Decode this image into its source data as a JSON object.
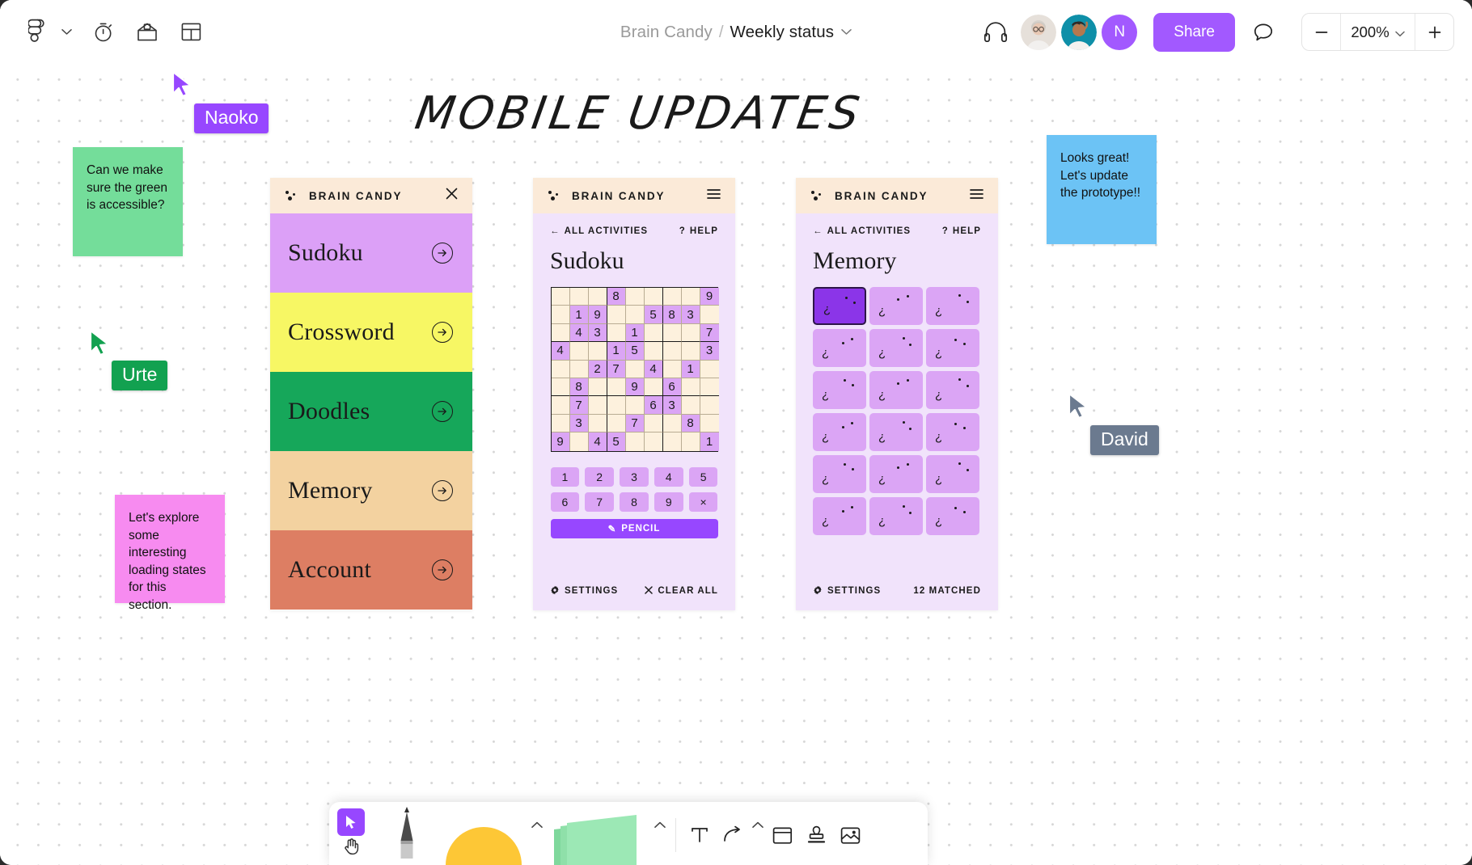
{
  "topbar": {
    "logo_icon": "figjam-logo-icon",
    "menu_caret_icon": "chevron-down-icon",
    "timer_icon": "timer-icon",
    "widget_icon": "widget-tray-icon",
    "template_icon": "template-icon",
    "breadcrumb": {
      "team": "Brain Candy",
      "separator": "/",
      "file": "Weekly status",
      "caret_icon": "chevron-down-icon"
    },
    "audio_icon": "headphones-icon",
    "avatars": [
      {
        "name": "collaborator-photo-1",
        "type": "photo",
        "accent": "#d9d2cc"
      },
      {
        "name": "collaborator-photo-2",
        "type": "photo",
        "accent": "#0e8fa8"
      },
      {
        "name": "collaborator-initial",
        "type": "initial",
        "initial": "N",
        "color": "#a259ff"
      }
    ],
    "share_label": "Share",
    "share_color": "#a259ff",
    "comment_icon": "comment-bubble-icon",
    "zoom": {
      "minus_icon": "minus-icon",
      "value": "200%",
      "caret_icon": "chevron-down-icon",
      "plus_icon": "plus-icon"
    }
  },
  "board": {
    "title": "MOBILE UPDATES",
    "stickies": [
      {
        "id": "green",
        "text": "Can we make sure the green is accessible?",
        "color": "#74dd9a"
      },
      {
        "id": "pink",
        "text": "Let's explore some interesting loading states for this section.",
        "color": "#f78bf0"
      },
      {
        "id": "blue",
        "text": "Looks great! Let's update the prototype!!",
        "color": "#6cc3f5"
      }
    ],
    "cursors": [
      {
        "name": "Naoko",
        "color": "#9747ff"
      },
      {
        "name": "Urte",
        "color": "#12a150"
      },
      {
        "name": "David",
        "color": "#6b7a8f"
      }
    ]
  },
  "phone1": {
    "brand": "BRAIN CANDY",
    "logo_icon": "brain-candy-dots-icon",
    "close_icon": "close-icon",
    "menu": [
      {
        "label": "Sudoku",
        "bg": "#dca0f7"
      },
      {
        "label": "Crossword",
        "bg": "#f7f764"
      },
      {
        "label": "Doodles",
        "bg": "#16a75a"
      },
      {
        "label": "Memory",
        "bg": "#f3d2a0"
      },
      {
        "label": "Account",
        "bg": "#dd7e63"
      }
    ],
    "arrow_icon": "arrow-right-circle-icon"
  },
  "phone2": {
    "brand": "BRAIN CANDY",
    "logo_icon": "brain-candy-dots-icon",
    "menu_icon": "hamburger-menu-icon",
    "back_label": "ALL ACTIVITIES",
    "back_icon": "arrow-left-icon",
    "help_label": "HELP",
    "help_icon": "question-mark-icon",
    "screen_title": "Sudoku",
    "sudoku": [
      [
        null,
        null,
        null,
        "8",
        null,
        null,
        null,
        null,
        "9"
      ],
      [
        null,
        "1",
        "9",
        null,
        null,
        "5",
        "8",
        "3",
        null
      ],
      [
        null,
        "4",
        "3",
        null,
        "1",
        null,
        null,
        null,
        "7"
      ],
      [
        "4",
        null,
        null,
        "1",
        "5",
        null,
        null,
        null,
        "3"
      ],
      [
        null,
        null,
        "2",
        "7",
        null,
        "4",
        null,
        "1",
        null
      ],
      [
        null,
        "8",
        null,
        null,
        "9",
        null,
        "6",
        null,
        null
      ],
      [
        null,
        "7",
        null,
        null,
        null,
        "6",
        "3",
        null,
        null
      ],
      [
        null,
        "3",
        null,
        null,
        "7",
        null,
        null,
        "8",
        null
      ],
      [
        "9",
        null,
        "4",
        "5",
        null,
        null,
        null,
        null,
        "1"
      ]
    ],
    "numpad": [
      "1",
      "2",
      "3",
      "4",
      "5",
      "6",
      "7",
      "8",
      "9",
      "×"
    ],
    "pencil_label": "PENCIL",
    "pencil_icon": "pencil-icon",
    "footer": [
      {
        "label": "SETTINGS",
        "icon": "gear-icon"
      },
      {
        "label": "CLEAR ALL",
        "icon": "close-x-icon"
      }
    ]
  },
  "phone3": {
    "brand": "BRAIN CANDY",
    "logo_icon": "brain-candy-dots-icon",
    "menu_icon": "hamburger-menu-icon",
    "back_label": "ALL ACTIVITIES",
    "back_icon": "arrow-left-icon",
    "help_label": "HELP",
    "help_icon": "question-mark-icon",
    "screen_title": "Memory",
    "card_count": 18,
    "active_card_index": 0,
    "card_face": "?",
    "footer": [
      {
        "label": "SETTINGS",
        "icon": "gear-icon"
      },
      {
        "label": "12 MATCHED",
        "icon": null
      }
    ]
  },
  "toolbar": {
    "cursor_icon": "cursor-arrow-icon",
    "hand_icon": "hand-pan-icon",
    "pen_icon": "marker-pen-icon",
    "shape_icon": "shape-tool-icon",
    "shape_caret_icon": "chevron-up-icon",
    "sticky_icon": "sticky-note-tool-icon",
    "sticky_caret_icon": "chevron-up-icon",
    "text_icon": "text-tool-icon",
    "connector_icon": "connector-arrow-icon",
    "connector_caret_icon": "chevron-up-icon",
    "section_icon": "section-frame-icon",
    "stamp_icon": "stamp-icon",
    "media_icon": "image-media-icon"
  }
}
